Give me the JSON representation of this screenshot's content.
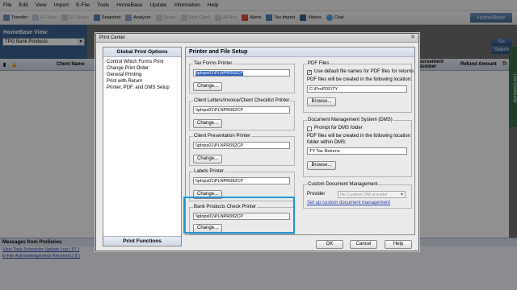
{
  "menu": [
    "File",
    "Edit",
    "View",
    "Import",
    "E-File",
    "Tools",
    "HomeBase",
    "Update",
    "Information",
    "Help"
  ],
  "toolbar": {
    "items": [
      "Transfer",
      "EF Now",
      "EF Status",
      "Snapshot",
      "Analyzer",
      "Query",
      "Find Client",
      "All Rec",
      "Alerts",
      "Tax Import",
      "Videos",
      "Chat"
    ],
    "brand": "HomeBase"
  },
  "homebase": {
    "title": "HomeBase View:",
    "selected_view": "TPG Bank Products"
  },
  "grid": {
    "columns": [
      "Client Name",
      "Disbursement Number",
      "Refund Amount",
      "Tr"
    ],
    "go_label": "Go",
    "search_label": "Search"
  },
  "side_tab_label": "Live Community",
  "messages": {
    "title": "Messages from ProSeries",
    "links": [
      "View Task Scheduler Update Log ( 57 )",
      "E-File Acknowledgments Received ( 8 )"
    ]
  },
  "dialog": {
    "title": "Print Center",
    "nav_header": "Global Print Options",
    "nav_items": [
      "Control Which Forms Print",
      "Change Print Order",
      "General Printing",
      "Print with Return",
      "Printer, PDF, and DMS Setup"
    ],
    "nav_footer": "Print Functions",
    "panel_title": "Printer and File Setup",
    "change_label": "Change...",
    "browse_label": "Browse...",
    "printers": [
      {
        "title": "Tax Forms Printer",
        "value": "\\\\plnps01\\PLNPR092CP"
      },
      {
        "title": "Client Letters/Invoice/Client Checklist Printer",
        "value": "\\\\plnps01\\PLNPR092CP"
      },
      {
        "title": "Client Presentation Printer",
        "value": "\\\\plnps01\\PLNPR092CP"
      },
      {
        "title": "Labels Printer",
        "value": "\\\\plnps01\\PLNPR092CP"
      },
      {
        "title": "Bank Products Check Printer",
        "value": "\\\\plnps01\\PLNPR092CP"
      }
    ],
    "pdf": {
      "title": "PDF Files",
      "checkbox_label": "Use default file names for PDF files for returns",
      "location_label": "PDF files will be created in the following location:",
      "path": "C:\\ProPDF\\TY"
    },
    "dms": {
      "title": "Document Management System (DMS)",
      "checkbox_label": "Prompt for DMS folder",
      "location_label": "PDF files will be created in the following location",
      "location_label2": "folder within DMS:",
      "path": "TY    Tax Returns"
    },
    "custom_dm": {
      "title": "Custom Document Management",
      "provider_label": "Provider",
      "provider_value": "No Custom DM provider",
      "setup_link": "Set up custom document management"
    },
    "buttons": {
      "ok": "OK",
      "cancel": "Cancel",
      "help": "Help"
    }
  }
}
